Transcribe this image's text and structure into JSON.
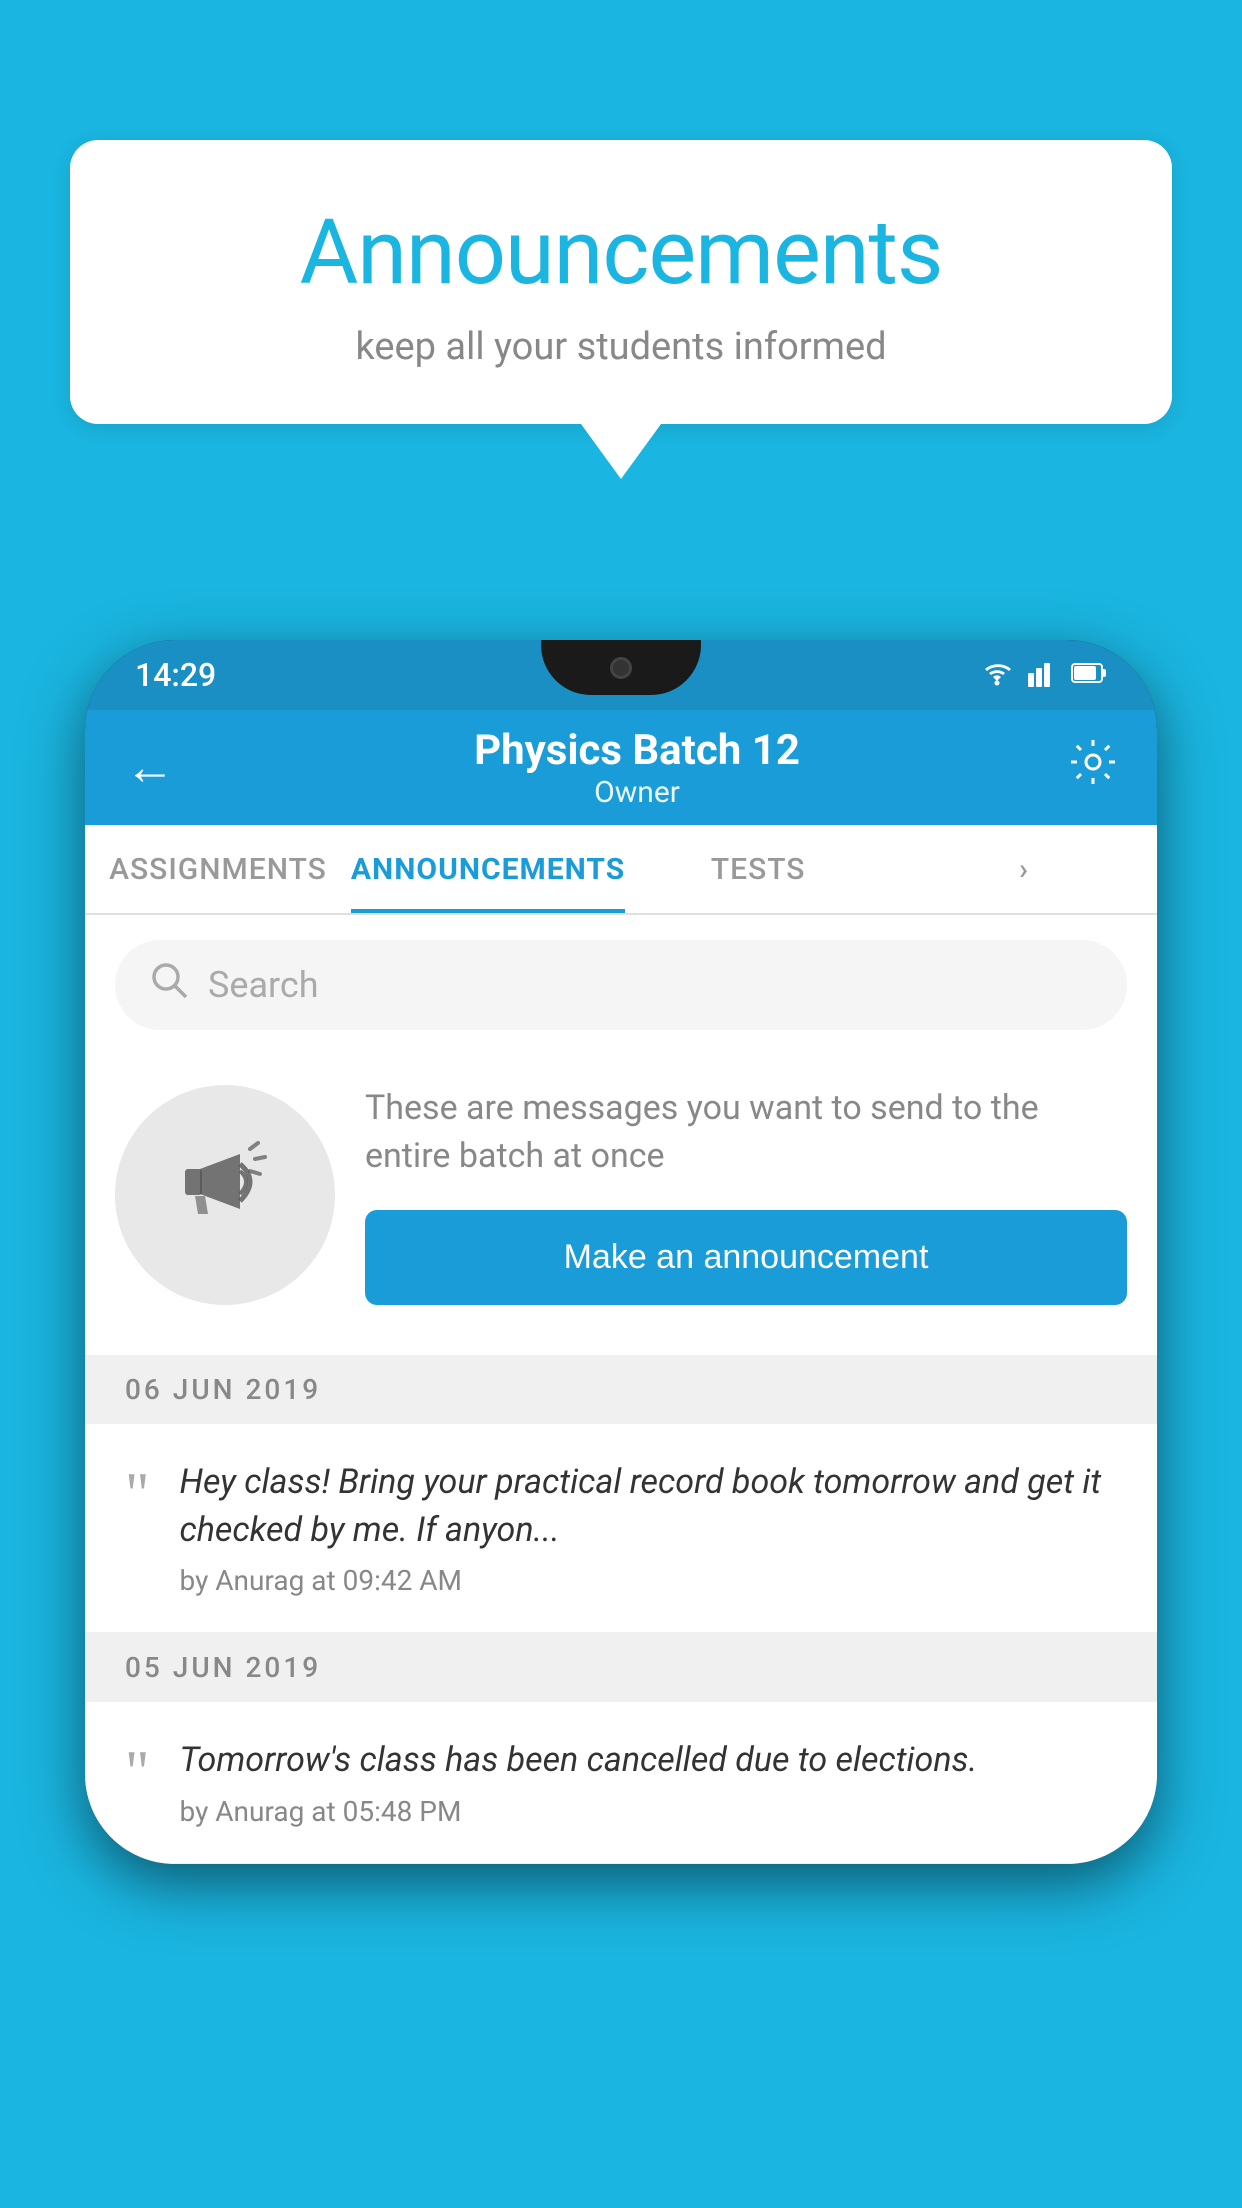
{
  "background_color": "#1ab5e0",
  "speech_bubble": {
    "title": "Announcements",
    "subtitle": "keep all your students informed"
  },
  "status_bar": {
    "time": "14:29",
    "wifi": "▾",
    "signal": "▲",
    "battery": "▮"
  },
  "app_bar": {
    "title": "Physics Batch 12",
    "subtitle": "Owner",
    "back_label": "←",
    "settings_label": "⚙"
  },
  "tabs": [
    {
      "label": "ASSIGNMENTS",
      "active": false
    },
    {
      "label": "ANNOUNCEMENTS",
      "active": true
    },
    {
      "label": "TESTS",
      "active": false
    },
    {
      "label": "...",
      "active": false
    }
  ],
  "search": {
    "placeholder": "Search"
  },
  "announcement_prompt": {
    "description": "These are messages you want to send to the entire batch at once",
    "button_label": "Make an announcement"
  },
  "announcements": [
    {
      "date": "06  JUN  2019",
      "message": "Hey class! Bring your practical record book tomorrow and get it checked by me. If anyon...",
      "author": "by Anurag at 09:42 AM"
    },
    {
      "date": "05  JUN  2019",
      "message": "Tomorrow's class has been cancelled due to elections.",
      "author": "by Anurag at 05:48 PM"
    }
  ]
}
